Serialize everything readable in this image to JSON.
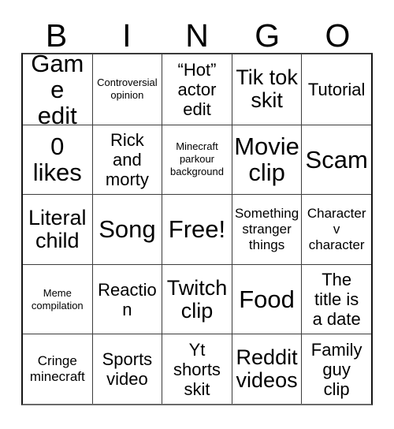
{
  "card": {
    "title": "BINGO Card",
    "header_letters": [
      "B",
      "I",
      "N",
      "G",
      "O"
    ],
    "rows": [
      [
        {
          "text": "Game\nedit",
          "size": "fs-xl"
        },
        {
          "text": "Controversial\nopinion",
          "size": "fs-xs"
        },
        {
          "text": "“Hot”\nactor\nedit",
          "size": "fs-md"
        },
        {
          "text": "Tik tok\nskit",
          "size": "fs-lg"
        },
        {
          "text": "Tutorial",
          "size": "fs-md"
        }
      ],
      [
        {
          "text": "0\nlikes",
          "size": "fs-xl"
        },
        {
          "text": "Rick\nand\nmorty",
          "size": "fs-md"
        },
        {
          "text": "Minecraft\nparkour\nbackground",
          "size": "fs-xs"
        },
        {
          "text": "Movie\nclip",
          "size": "fs-xl"
        },
        {
          "text": "Scam",
          "size": "fs-xl"
        }
      ],
      [
        {
          "text": "Literal\nchild",
          "size": "fs-lg"
        },
        {
          "text": "Song",
          "size": "fs-xl"
        },
        {
          "text": "Free!",
          "size": "fs-xl"
        },
        {
          "text": "Something\nstranger\nthings",
          "size": "fs-sm"
        },
        {
          "text": "Character\nv\ncharacter",
          "size": "fs-sm"
        }
      ],
      [
        {
          "text": "Meme\ncompilation",
          "size": "fs-xs"
        },
        {
          "text": "Reaction",
          "size": "fs-md"
        },
        {
          "text": "Twitch\nclip",
          "size": "fs-lg"
        },
        {
          "text": "Food",
          "size": "fs-xl"
        },
        {
          "text": "The\ntitle is\na date",
          "size": "fs-md"
        }
      ],
      [
        {
          "text": "Cringe\nminecraft",
          "size": "fs-sm"
        },
        {
          "text": "Sports\nvideo",
          "size": "fs-md"
        },
        {
          "text": "Yt\nshorts\nskit",
          "size": "fs-md"
        },
        {
          "text": "Reddit\nvideos",
          "size": "fs-lg"
        },
        {
          "text": "Family\nguy\nclip",
          "size": "fs-md"
        }
      ]
    ]
  }
}
